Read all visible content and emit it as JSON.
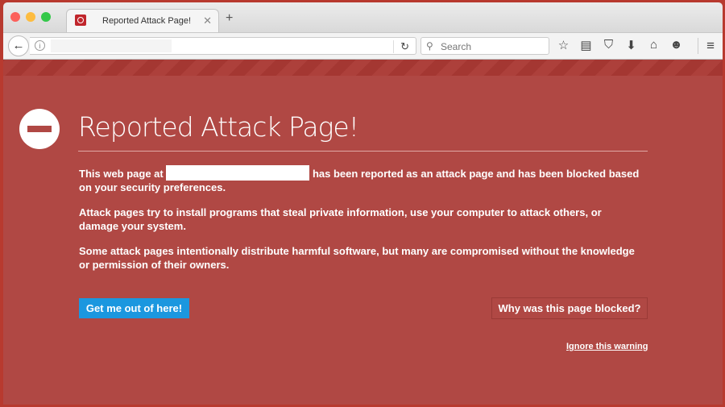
{
  "tab": {
    "title": "Reported Attack Page!",
    "close": "✕",
    "new_tab": "+"
  },
  "navbar": {
    "search_placeholder": "Search",
    "url_value": ""
  },
  "page": {
    "title": "Reported Attack Page!",
    "p1_before": "This web page at ",
    "p1_after": " has been reported as an attack page and has been blocked based on your security preferences.",
    "p2": "Attack pages try to install programs that steal private information, use your computer to attack others, or damage your system.",
    "p3": "Some attack pages intentionally distribute harmful software, but many are compromised without the knowledge or permission of their owners.",
    "get_out": "Get me out of here!",
    "why_blocked": "Why was this page blocked?",
    "ignore": "Ignore this warning"
  },
  "colors": {
    "background": "#b04844",
    "primary_button": "#1b97df"
  }
}
